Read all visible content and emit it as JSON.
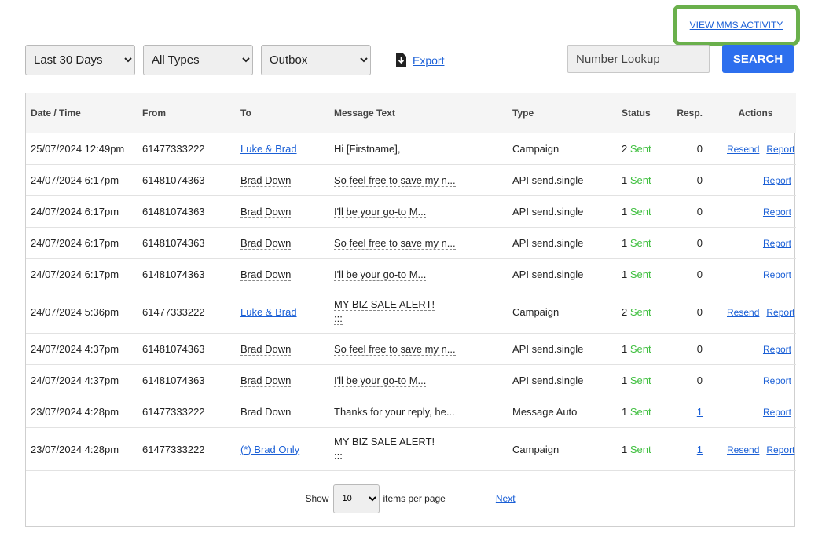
{
  "header": {
    "mms_activity_link": "VIEW MMS ACTIVITY",
    "highlight_color": "#6ab04c"
  },
  "filters": {
    "date_range": {
      "selected": "Last 30 Days",
      "options": [
        "Last 30 Days"
      ]
    },
    "type": {
      "selected": "All Types",
      "options": [
        "All Types"
      ]
    },
    "folder": {
      "selected": "Outbox",
      "options": [
        "Outbox"
      ]
    },
    "export_label": "Export",
    "export_icon": "download-file-icon"
  },
  "search": {
    "placeholder": "Number Lookup",
    "button_label": "SEARCH",
    "button_color": "#2d6fee"
  },
  "table": {
    "columns": [
      "Date / Time",
      "From",
      "To",
      "Message Text",
      "Type",
      "Status",
      "Resp.",
      "Actions"
    ],
    "rows": [
      {
        "datetime": "25/07/2024 12:49pm",
        "from": "61477333222",
        "to": "Luke & Brad",
        "to_link": true,
        "message": "Hi [Firstname],",
        "message2": "",
        "type": "Campaign",
        "status_count": "2",
        "status_text": "Sent",
        "resp": "0",
        "resp_link": false,
        "resend": "Resend",
        "report": "Report"
      },
      {
        "datetime": "24/07/2024 6:17pm",
        "from": "61481074363",
        "to": "Brad Down",
        "to_link": false,
        "message": "So feel free to save my n...",
        "message2": "",
        "type": "API send.single",
        "status_count": "1",
        "status_text": "Sent",
        "resp": "0",
        "resp_link": false,
        "resend": "",
        "report": "Report"
      },
      {
        "datetime": "24/07/2024 6:17pm",
        "from": "61481074363",
        "to": "Brad Down",
        "to_link": false,
        "message": "I'll be your go-to M...",
        "message2": "",
        "type": "API send.single",
        "status_count": "1",
        "status_text": "Sent",
        "resp": "0",
        "resp_link": false,
        "resend": "",
        "report": "Report"
      },
      {
        "datetime": "24/07/2024 6:17pm",
        "from": "61481074363",
        "to": "Brad Down",
        "to_link": false,
        "message": "So feel free to save my n...",
        "message2": "",
        "type": "API send.single",
        "status_count": "1",
        "status_text": "Sent",
        "resp": "0",
        "resp_link": false,
        "resend": "",
        "report": "Report"
      },
      {
        "datetime": "24/07/2024 6:17pm",
        "from": "61481074363",
        "to": "Brad Down",
        "to_link": false,
        "message": "I'll be your go-to M...",
        "message2": "",
        "type": "API send.single",
        "status_count": "1",
        "status_text": "Sent",
        "resp": "0",
        "resp_link": false,
        "resend": "",
        "report": "Report"
      },
      {
        "datetime": "24/07/2024 5:36pm",
        "from": "61477333222",
        "to": "Luke & Brad",
        "to_link": true,
        "message": "MY BIZ SALE ALERT!",
        "message2": ":::",
        "type": "Campaign",
        "status_count": "2",
        "status_text": "Sent",
        "resp": "0",
        "resp_link": false,
        "resend": "Resend",
        "report": "Report"
      },
      {
        "datetime": "24/07/2024 4:37pm",
        "from": "61481074363",
        "to": "Brad Down",
        "to_link": false,
        "message": "So feel free to save my n...",
        "message2": "",
        "type": "API send.single",
        "status_count": "1",
        "status_text": "Sent",
        "resp": "0",
        "resp_link": false,
        "resend": "",
        "report": "Report"
      },
      {
        "datetime": "24/07/2024 4:37pm",
        "from": "61481074363",
        "to": "Brad Down",
        "to_link": false,
        "message": "I'll be your go-to M...",
        "message2": "",
        "type": "API send.single",
        "status_count": "1",
        "status_text": "Sent",
        "resp": "0",
        "resp_link": false,
        "resend": "",
        "report": "Report"
      },
      {
        "datetime": "23/07/2024 4:28pm",
        "from": "61477333222",
        "to": "Brad Down",
        "to_link": false,
        "message": "Thanks for your reply, he...",
        "message2": "",
        "type": "Message Auto",
        "status_count": "1",
        "status_text": "Sent",
        "resp": "1",
        "resp_link": true,
        "resend": "",
        "report": "Report"
      },
      {
        "datetime": "23/07/2024 4:28pm",
        "from": "61477333222",
        "to": "(*) Brad Only",
        "to_link": true,
        "message": "MY BIZ SALE ALERT!",
        "message2": ":::",
        "type": "Campaign",
        "status_count": "1",
        "status_text": "Sent",
        "resp": "1",
        "resp_link": true,
        "resend": "Resend",
        "report": "Report"
      }
    ]
  },
  "pagination": {
    "show_label": "Show",
    "per_page": "10",
    "per_page_options": [
      "10"
    ],
    "items_label": "items per page",
    "next_label": "Next"
  }
}
